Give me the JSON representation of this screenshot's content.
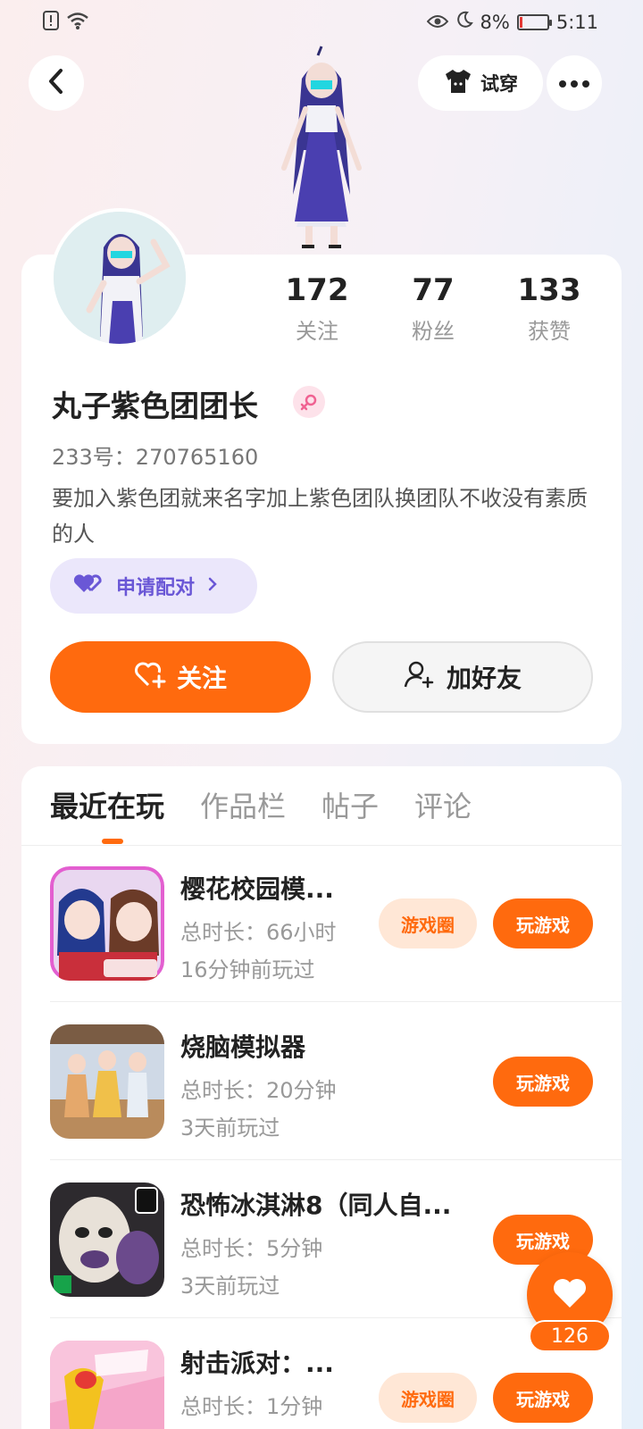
{
  "status_bar": {
    "battery": "8%",
    "time": "5:11"
  },
  "header": {
    "tryon_label": "试穿"
  },
  "profile": {
    "stats": [
      {
        "value": "172",
        "label": "关注"
      },
      {
        "value": "77",
        "label": "粉丝"
      },
      {
        "value": "133",
        "label": "获赞"
      }
    ],
    "nickname": "丸子紫色团团长",
    "uid": "233号：270765160",
    "bio": "要加入紫色团就来名字加上紫色团队换团队不收没有素质的人",
    "pair_label": "申请配对",
    "follow_label": "关注",
    "add_friend_label": "加好友"
  },
  "tabs": [
    "最近在玩",
    "作品栏",
    "帖子",
    "评论"
  ],
  "circle_label": "游戏圈",
  "play_label": "玩游戏",
  "games": [
    {
      "title": "樱花校园模...",
      "duration": "总时长：66小时",
      "last_played": "16分钟前玩过",
      "has_circle": true
    },
    {
      "title": "烧脑模拟器",
      "duration": "总时长：20分钟",
      "last_played": "3天前玩过",
      "has_circle": false
    },
    {
      "title": "恐怖冰淇淋8（同人自...",
      "duration": "总时长：5分钟",
      "last_played": "3天前玩过",
      "has_circle": false
    },
    {
      "title": "射击派对：...",
      "duration": "总时长：1分钟",
      "last_played": "",
      "has_circle": true
    }
  ],
  "like_count": "126",
  "colors": {
    "accent": "#ff6a0e",
    "pair_purple": "#6a57d6"
  }
}
